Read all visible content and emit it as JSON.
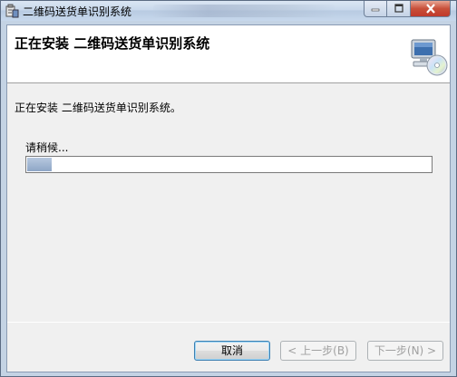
{
  "window": {
    "title": "二维码送货单识别系统"
  },
  "header": {
    "title": "正在安装 二维码送货单识别系统"
  },
  "body": {
    "description": "正在安装 二维码送货单识别系统。",
    "wait_text": "请稍候...",
    "progress_percent": 6
  },
  "buttons": {
    "cancel": "取消",
    "back": "< 上一步(B)",
    "next": "下一步(N) >"
  },
  "icons": {
    "app": "installer-app-icon",
    "header": "computer-with-cd-icon",
    "minimize": "minimize-icon",
    "maximize": "maximize-icon",
    "close": "close-icon"
  }
}
